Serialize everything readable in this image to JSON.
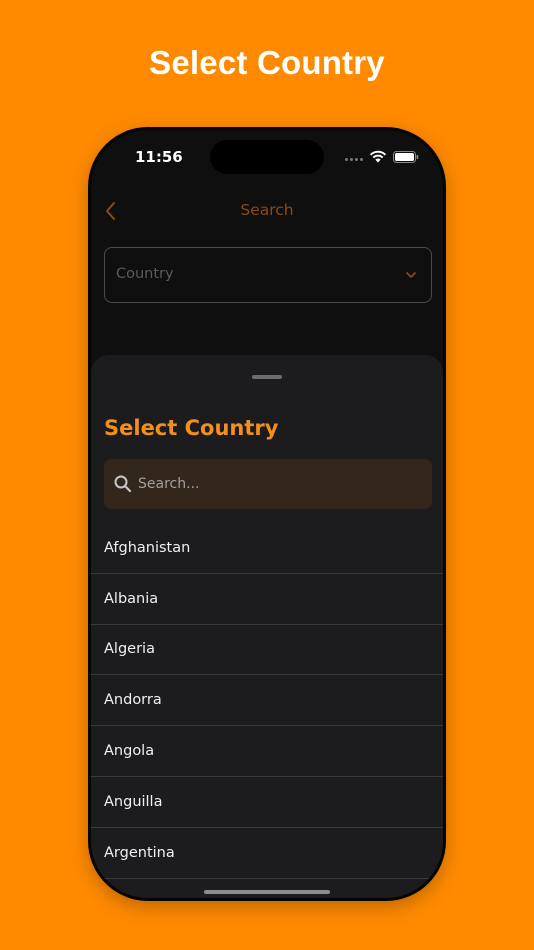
{
  "promo": {
    "title": "Select Country"
  },
  "status_bar": {
    "time": "11:56"
  },
  "nav": {
    "title": "Search",
    "back_icon": "chevron-left-icon"
  },
  "country_field": {
    "label": "Country",
    "icon": "chevron-down-icon"
  },
  "sheet": {
    "title": "Select Country",
    "search_placeholder": "Search...",
    "countries": [
      "Afghanistan",
      "Albania",
      "Algeria",
      "Andorra",
      "Angola",
      "Anguilla",
      "Argentina"
    ]
  },
  "colors": {
    "background": "#FF8A00",
    "accent": "#F2901E",
    "sheet": "#1C1C1F",
    "search_bg": "#33261B"
  }
}
